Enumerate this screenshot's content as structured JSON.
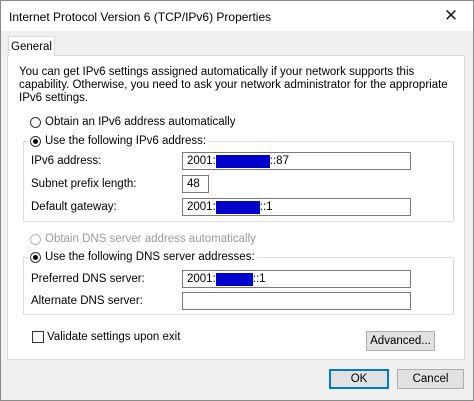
{
  "window": {
    "title": "Internet Protocol Version 6 (TCP/IPv6) Properties",
    "close_glyph": "✕"
  },
  "tabs": [
    {
      "label": "General"
    }
  ],
  "intro_text": "You can get IPv6 settings assigned automatically if your network supports this capability. Otherwise, you need to ask your network administrator for the appropriate IPv6 settings.",
  "address": {
    "auto_label": "Obtain an IPv6 address automatically",
    "manual_label": "Use the following IPv6 address:",
    "selected": "manual",
    "fields": {
      "ipv6_label": "IPv6 address:",
      "ipv6_prefix": "2001:",
      "ipv6_suffix": "::87",
      "prefix_label": "Subnet prefix length:",
      "prefix_value": "48",
      "gateway_label": "Default gateway:",
      "gateway_prefix": "2001:",
      "gateway_suffix": "::1"
    }
  },
  "dns": {
    "auto_label": "Obtain DNS server address automatically",
    "manual_label": "Use the following DNS server addresses:",
    "selected": "manual",
    "preferred_label": "Preferred DNS server:",
    "preferred_prefix": "2001:",
    "preferred_suffix": "::1",
    "alternate_label": "Alternate DNS server:",
    "alternate_value": ""
  },
  "validate": {
    "label": "Validate settings upon exit",
    "checked": false
  },
  "buttons": {
    "advanced": "Advanced...",
    "ok": "OK",
    "cancel": "Cancel"
  },
  "colors": {
    "redaction": "#0000cc",
    "accent": "#0078d7"
  }
}
